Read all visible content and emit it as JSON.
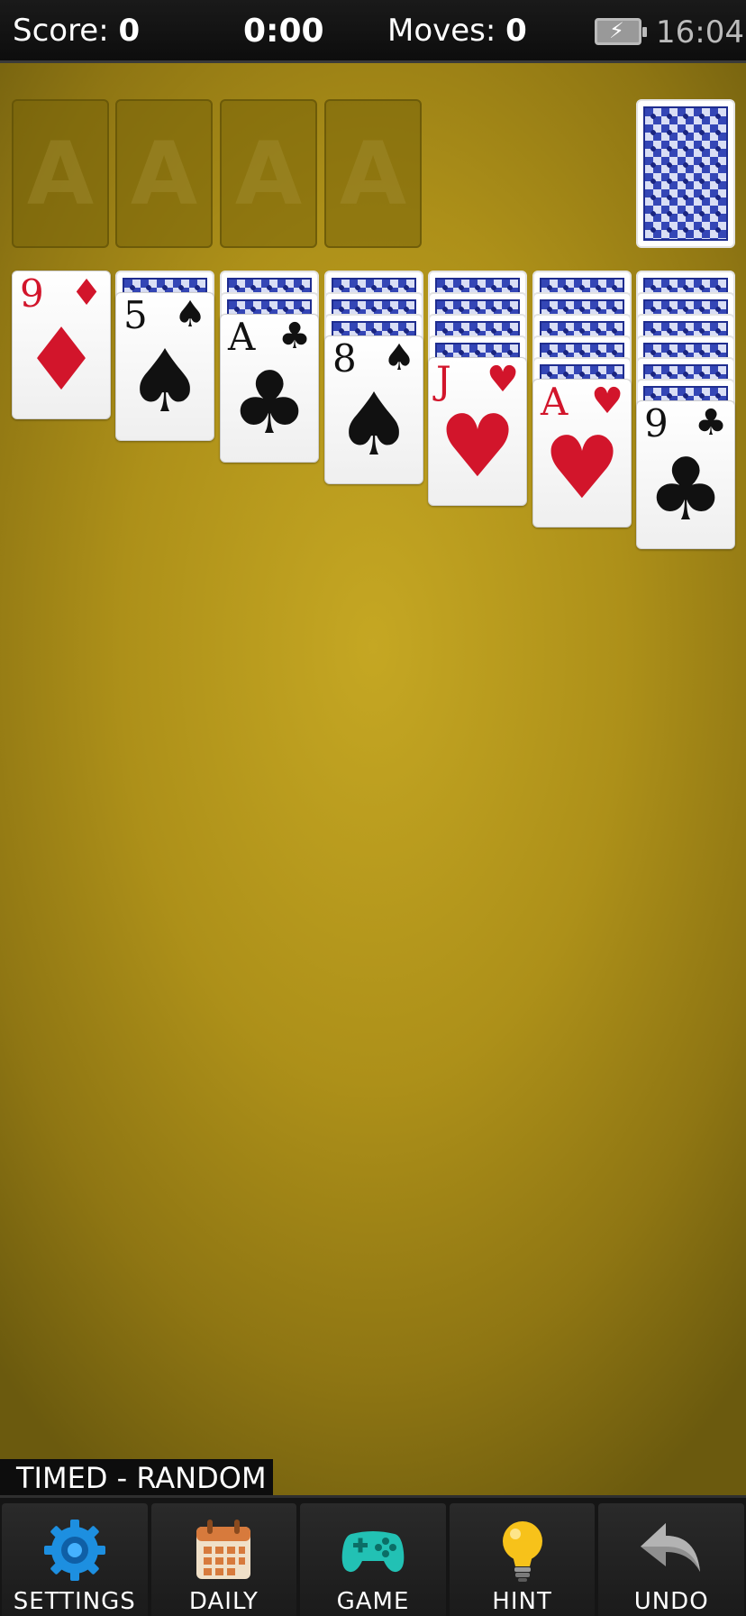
{
  "status": {
    "score_label": "Score:",
    "score_value": "0",
    "timer": "0:00",
    "moves_label": "Moves:",
    "moves_value": "0",
    "clock": "16:04"
  },
  "foundations": [
    "A",
    "A",
    "A",
    "A"
  ],
  "tableau": [
    {
      "face_down": 0,
      "rank": "9",
      "suit": "♦",
      "color": "red"
    },
    {
      "face_down": 1,
      "rank": "5",
      "suit": "♠",
      "color": "black"
    },
    {
      "face_down": 2,
      "rank": "A",
      "suit": "♣",
      "color": "black"
    },
    {
      "face_down": 3,
      "rank": "8",
      "suit": "♠",
      "color": "black"
    },
    {
      "face_down": 4,
      "rank": "J",
      "suit": "♥",
      "color": "red"
    },
    {
      "face_down": 5,
      "rank": "A",
      "suit": "♥",
      "color": "red"
    },
    {
      "face_down": 6,
      "rank": "9",
      "suit": "♣",
      "color": "black"
    }
  ],
  "mode_label": "TIMED - RANDOM",
  "toolbar": {
    "settings": "SETTINGS",
    "daily": "DAILY",
    "game": "GAME",
    "hint": "HINT",
    "undo": "UNDO"
  },
  "colors": {
    "felt": "#c5a723",
    "red_suit": "#d2152b",
    "card_back": "#3446b6"
  }
}
